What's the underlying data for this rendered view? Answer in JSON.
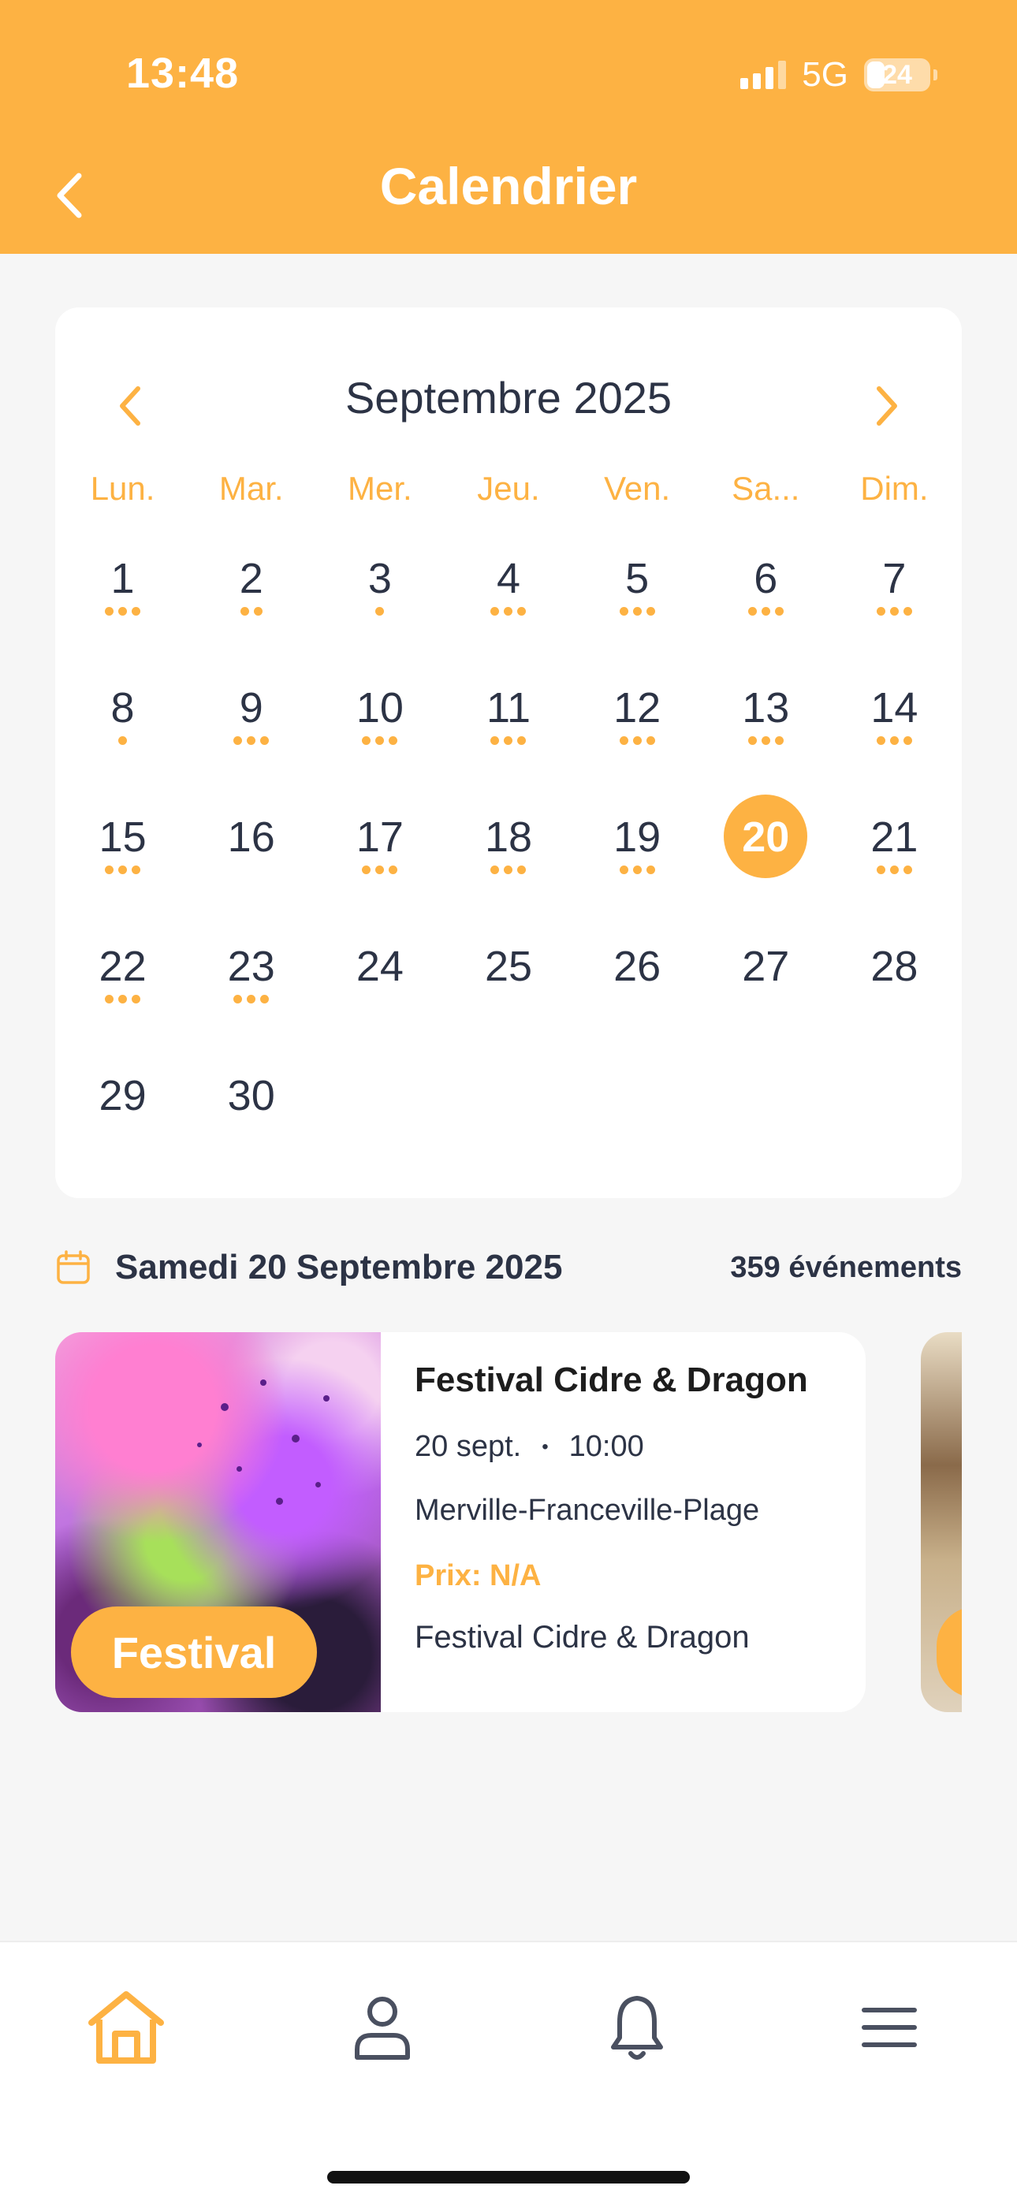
{
  "status_bar": {
    "time": "13:48",
    "network": "5G",
    "battery": "24"
  },
  "header": {
    "title": "Calendrier"
  },
  "calendar": {
    "month_title": "Septembre 2025",
    "weekdays": [
      "Lun.",
      "Mar.",
      "Mer.",
      "Jeu.",
      "Ven.",
      "Sa...",
      "Dim."
    ],
    "days": [
      {
        "n": "1",
        "dots": 3
      },
      {
        "n": "2",
        "dots": 2
      },
      {
        "n": "3",
        "dots": 1
      },
      {
        "n": "4",
        "dots": 3
      },
      {
        "n": "5",
        "dots": 3
      },
      {
        "n": "6",
        "dots": 3
      },
      {
        "n": "7",
        "dots": 3
      },
      {
        "n": "8",
        "dots": 1
      },
      {
        "n": "9",
        "dots": 3
      },
      {
        "n": "10",
        "dots": 3
      },
      {
        "n": "11",
        "dots": 3
      },
      {
        "n": "12",
        "dots": 3
      },
      {
        "n": "13",
        "dots": 3
      },
      {
        "n": "14",
        "dots": 3
      },
      {
        "n": "15",
        "dots": 3
      },
      {
        "n": "16",
        "dots": 0
      },
      {
        "n": "17",
        "dots": 3
      },
      {
        "n": "18",
        "dots": 3
      },
      {
        "n": "19",
        "dots": 3
      },
      {
        "n": "20",
        "dots": 0,
        "selected": true
      },
      {
        "n": "21",
        "dots": 3
      },
      {
        "n": "22",
        "dots": 3
      },
      {
        "n": "23",
        "dots": 3
      },
      {
        "n": "24",
        "dots": 0
      },
      {
        "n": "25",
        "dots": 0
      },
      {
        "n": "26",
        "dots": 0
      },
      {
        "n": "27",
        "dots": 0
      },
      {
        "n": "28",
        "dots": 0
      },
      {
        "n": "29",
        "dots": 0
      },
      {
        "n": "30",
        "dots": 0
      }
    ]
  },
  "events": {
    "date_label": "Samedi 20 Septembre 2025",
    "count_label": "359 événements",
    "cards": [
      {
        "badge": "Festival",
        "title": "Festival Cidre & Dragon",
        "date": "20 sept.",
        "separator": "•",
        "time": "10:00",
        "place": "Merville-Franceville-Plage",
        "price": "Prix: N/A",
        "subtitle": "Festival Cidre & Dragon"
      }
    ]
  },
  "nav": {
    "items": [
      "home-icon",
      "profile-icon",
      "bell-icon",
      "menu-icon"
    ]
  },
  "colors": {
    "accent": "#fdb243",
    "text": "#2c3345",
    "background": "#f6f6f6",
    "nav_inactive": "#4a5060"
  }
}
